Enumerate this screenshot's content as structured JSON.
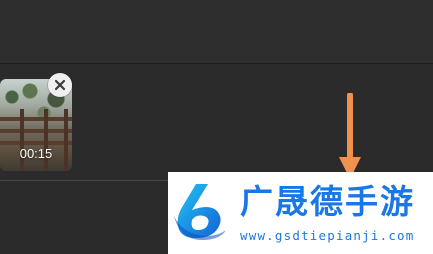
{
  "clip": {
    "duration": "00:15"
  },
  "icons": {
    "close": "close-icon",
    "arrow": "arrow-down-icon"
  },
  "watermark": {
    "title": "广晟德手游",
    "url": "www.gsdtiepianji.com",
    "logo": "gsd-logo"
  },
  "colors": {
    "background": "#2b2b2b",
    "top_bar": "#2e2e2e",
    "arrow": "#f0914f",
    "watermark_blue": "#1a78e6",
    "close_button": "#efefef"
  }
}
